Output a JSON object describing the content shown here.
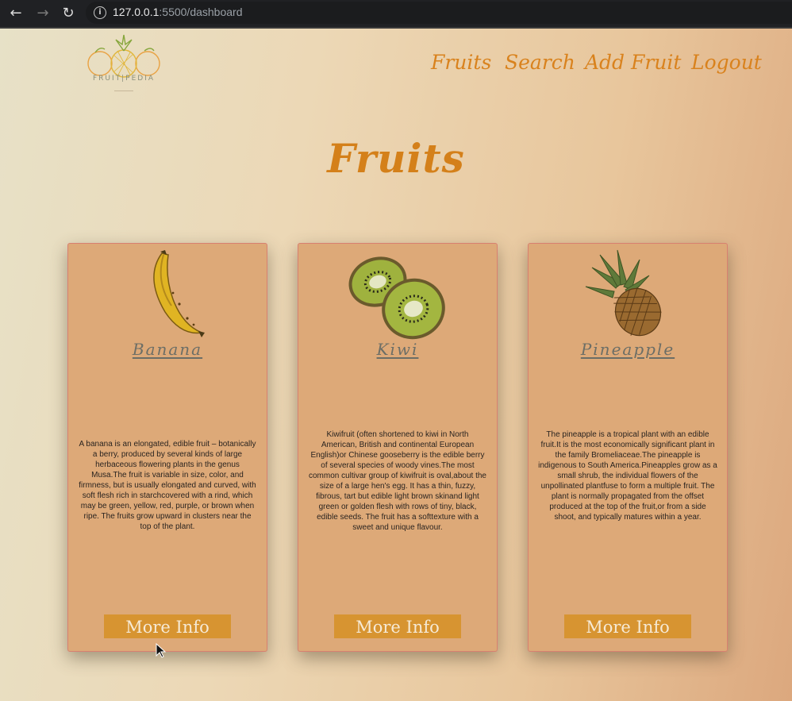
{
  "browser": {
    "url_host": "127.0.0.1",
    "url_rest": ":5500/dashboard"
  },
  "logo": {
    "text": "FRUIT|PEDIA"
  },
  "nav": [
    {
      "label": "Fruits"
    },
    {
      "label": "Search"
    },
    {
      "label": "Add Fruit"
    },
    {
      "label": "Logout"
    }
  ],
  "page_title": "Fruits",
  "cards": [
    {
      "name": "Banana",
      "image": "banana-image",
      "description": "A banana is an elongated, edible fruit – botanically a berry, produced by several kinds of large herbaceous flowering plants in the genus Musa.The fruit is variable in size, color, and firmness, but is usually elongated and curved, with soft flesh rich in starchcovered with a rind, which may be green, yellow, red, purple, or brown when ripe. The fruits grow upward in clusters near the top of the plant.",
      "button": "More Info"
    },
    {
      "name": "Kiwi",
      "image": "kiwi-image",
      "description": "Kiwifruit (often shortened to kiwi in North American, British and continental European English)or Chinese gooseberry is the edible berry of several species of woody vines.The most common cultivar group of kiwifruit is oval,about the size of a large hen's egg. It has a thin, fuzzy, fibrous, tart but edible light brown skinand light green or golden flesh with rows of tiny, black, edible seeds. The fruit has a softtexture with a sweet and unique flavour.",
      "button": "More Info"
    },
    {
      "name": "Pineapple",
      "image": "pineapple-image",
      "description": "The pineapple is a tropical plant with an edible fruit.It is the most economically significant plant in the family Bromeliaceae.The pineapple is indigenous to South America.Pineapples grow as a small shrub, the individual flowers of the unpollinated plantfuse to form a multiple fruit. The plant is normally propagated from the offset produced at the top of the fruit,or from a side shoot, and typically matures within a year.",
      "button": "More Info"
    }
  ],
  "colors": {
    "accent": "#d9821d",
    "card_bg": "#dda978",
    "button_bg": "#d79431"
  }
}
